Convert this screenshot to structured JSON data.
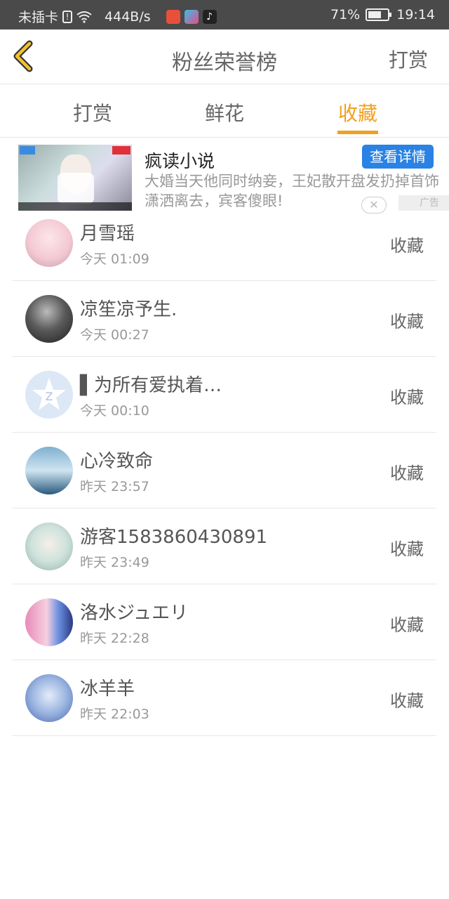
{
  "status_bar": {
    "carrier": "未插卡",
    "speed": "444B/s",
    "battery": "71%",
    "battery_level": 0.71,
    "time": "19:14"
  },
  "header": {
    "title": "粉丝荣誉榜",
    "action": "打赏"
  },
  "tabs": [
    {
      "label": "打赏",
      "active": false
    },
    {
      "label": "鲜花",
      "active": false
    },
    {
      "label": "收藏",
      "active": true
    }
  ],
  "ad": {
    "title": "疯读小说",
    "button": "查看详情",
    "description": "大婚当天他同时纳妾，王妃散开盘发扔掉首饰潇洒离去，宾客傻眼!",
    "close": "✕",
    "label": "广告"
  },
  "fans": [
    {
      "name": "月雪瑶",
      "time": "今天 01:09",
      "action": "收藏",
      "avatar_color": "#f3c9d3"
    },
    {
      "name": "凉笙凉予生.",
      "time": "今天 00:27",
      "action": "收藏",
      "avatar_color": "#3a3a3a"
    },
    {
      "name": "▌为所有爱执着…",
      "time": "今天 00:10",
      "action": "收藏",
      "avatar_color": "#dce8f6"
    },
    {
      "name": "心冷致命",
      "time": "昨天 23:57",
      "action": "收藏",
      "avatar_color": "#9cc4dc"
    },
    {
      "name": "游客1583860430891",
      "time": "昨天 23:49",
      "action": "收藏",
      "avatar_color": "#d8e8e4"
    },
    {
      "name": "洛水ジュエリ",
      "time": "昨天 22:28",
      "action": "收藏",
      "avatar_color": "#c87ab0"
    },
    {
      "name": "冰羊羊",
      "time": "昨天 22:03",
      "action": "收藏",
      "avatar_color": "#9ab4e0"
    }
  ],
  "colors": {
    "accent": "#f0a020",
    "ad_button": "#2a82e4"
  }
}
